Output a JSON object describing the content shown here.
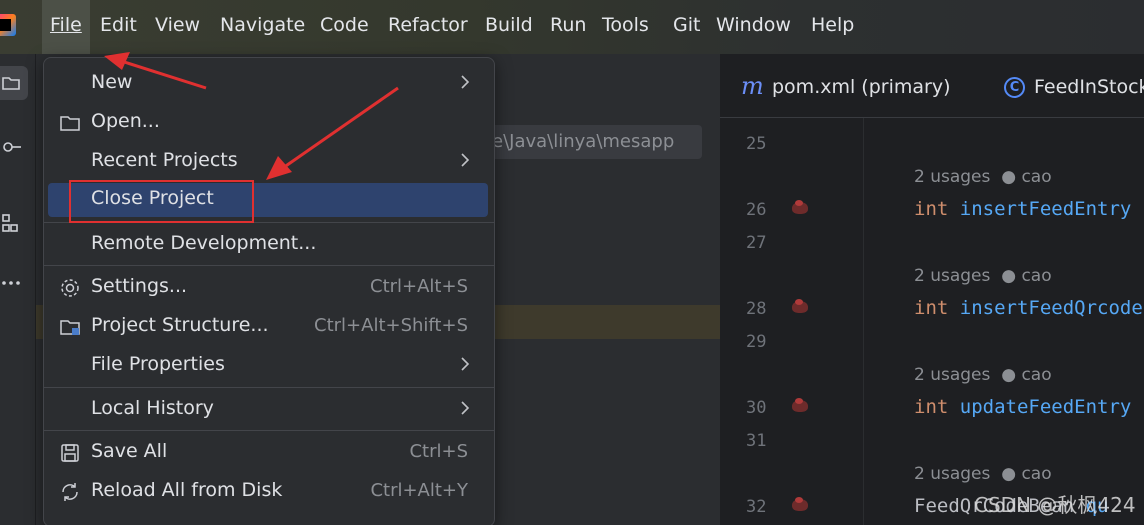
{
  "menubar": {
    "items": [
      {
        "label": "File",
        "active": true
      },
      {
        "label": "Edit"
      },
      {
        "label": "View"
      },
      {
        "label": "Navigate"
      },
      {
        "label": "Code"
      },
      {
        "label": "Refactor"
      },
      {
        "label": "Build"
      },
      {
        "label": "Run"
      },
      {
        "label": "Tools"
      },
      {
        "label": "Git"
      },
      {
        "label": "Window"
      },
      {
        "label": "Help"
      }
    ]
  },
  "project_panel": {
    "path_value": "e\\Java\\linya\\mesapp"
  },
  "file_menu": {
    "items": [
      {
        "label": "New",
        "icon": "",
        "shortcut": "",
        "submenu": true
      },
      {
        "label": "Open...",
        "icon": "folder-icon",
        "shortcut": "",
        "submenu": false
      },
      {
        "label": "Recent Projects",
        "icon": "",
        "shortcut": "",
        "submenu": true
      },
      {
        "label": "Close Project",
        "icon": "",
        "shortcut": "",
        "submenu": false,
        "selected": true
      },
      {
        "label": "Remote Development...",
        "icon": "",
        "shortcut": "",
        "submenu": false
      },
      {
        "label": "Settings...",
        "icon": "gear-icon",
        "shortcut": "Ctrl+Alt+S",
        "submenu": false
      },
      {
        "label": "Project Structure...",
        "icon": "project-structure-icon",
        "shortcut": "Ctrl+Alt+Shift+S",
        "submenu": false
      },
      {
        "label": "File Properties",
        "icon": "",
        "shortcut": "",
        "submenu": true
      },
      {
        "label": "Local History",
        "icon": "",
        "shortcut": "",
        "submenu": true
      },
      {
        "label": "Save All",
        "icon": "save-icon",
        "shortcut": "Ctrl+S",
        "submenu": false
      },
      {
        "label": "Reload All from Disk",
        "icon": "reload-icon",
        "shortcut": "Ctrl+Alt+Y",
        "submenu": false
      }
    ]
  },
  "editor": {
    "tabs": [
      {
        "label": "pom.xml (primary)",
        "icon": "maven-icon"
      },
      {
        "label": "FeedInStock",
        "icon": "class-icon"
      }
    ],
    "tab_icon_text": {
      "maven": "m",
      "class": "C"
    },
    "lines": [
      {
        "no": "25"
      },
      {
        "no": "26",
        "usages": "2 usages",
        "author": "cao",
        "kw": "int",
        "fn": "insertFeedEntry"
      },
      {
        "no": "27"
      },
      {
        "no": "28",
        "usages": "2 usages",
        "author": "cao",
        "kw": "int",
        "fn": "insertFeedQrcode"
      },
      {
        "no": "29"
      },
      {
        "no": "30",
        "usages": "2 usages",
        "author": "cao",
        "kw": "int",
        "fn": "updateFeedEntry"
      },
      {
        "no": "31"
      },
      {
        "no": "32",
        "usages": "2 usages",
        "author": "cao",
        "cls": "FeedQrCodeBean",
        "fn": "qu"
      }
    ]
  },
  "watermark": "CSDN @秋枫424",
  "colors": {
    "accent_selection": "#2e436e",
    "annotation_red": "#e03030",
    "keyword": "#cf8e6d",
    "function": "#56a8f5"
  }
}
